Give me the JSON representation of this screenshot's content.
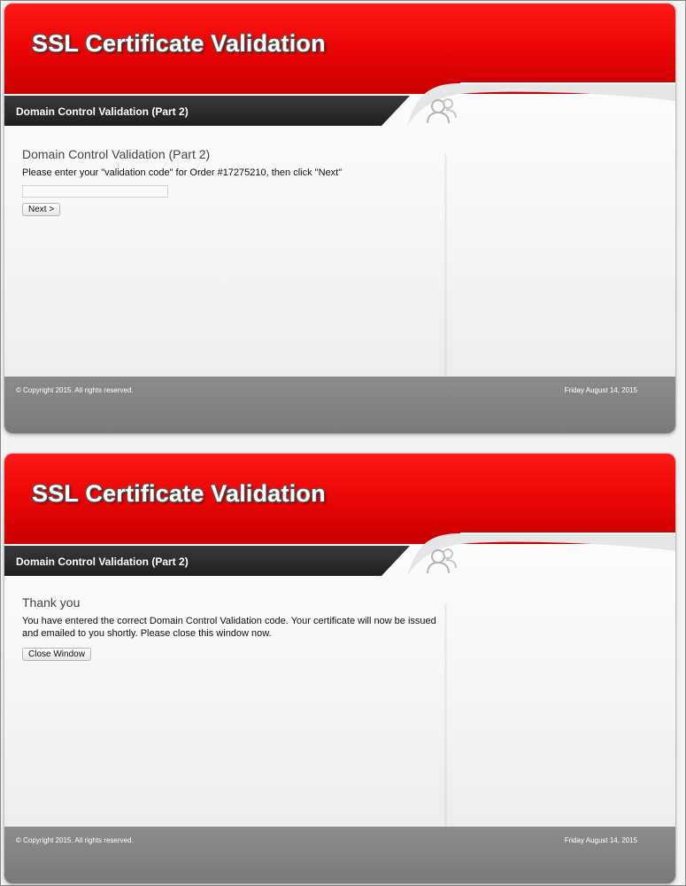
{
  "screens": [
    {
      "header": {
        "title": "SSL Certificate Validation"
      },
      "subbar": {
        "title": "Domain Control Validation (Part 2)"
      },
      "content": {
        "heading": "Domain Control Validation (Part 2)",
        "text": "Please enter your \"validation code\" for Order #17275210, then click \"Next\"",
        "input": {
          "value": "",
          "placeholder": ""
        },
        "button_label": "Next >"
      },
      "footer": {
        "copyright": "© Copyright 2015. All rights reserved.",
        "date": "Friday August 14, 2015"
      }
    },
    {
      "header": {
        "title": "SSL Certificate Validation"
      },
      "subbar": {
        "title": "Domain Control Validation (Part 2)"
      },
      "content": {
        "heading": "Thank you",
        "text": "You have entered the correct Domain Control Validation code. Your certificate will now be issued and emailed to you shortly. Please close this window now.",
        "button_label": "Close Window"
      },
      "footer": {
        "copyright": "© Copyright 2015. All rights reserved.",
        "date": "Friday August 14, 2015"
      }
    }
  ],
  "icons": {
    "user": "users-icon"
  },
  "colors": {
    "header_red": "#ec0606",
    "subbar_dark": "#1f1f1f",
    "footer_gray": "#7f7f7f"
  }
}
